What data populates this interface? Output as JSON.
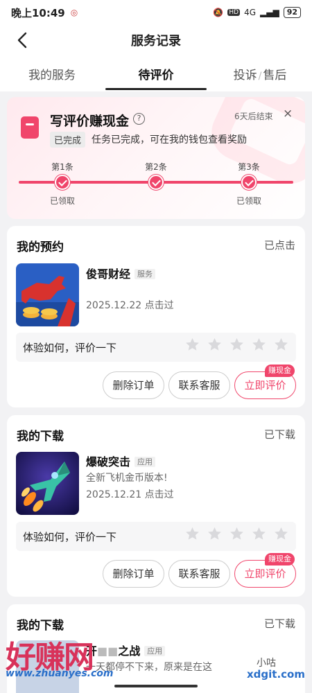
{
  "status_bar": {
    "time": "晚上10:49",
    "network": "4G",
    "battery": "92"
  },
  "navbar": {
    "title": "服务记录"
  },
  "tabs": [
    {
      "label": "我的服务",
      "active": false
    },
    {
      "label": "待评价",
      "active": true
    },
    {
      "label_a": "投诉",
      "label_b": "售后",
      "active": false
    }
  ],
  "promo": {
    "title": "写评价赚现金",
    "help_icon": "?",
    "deadline": "6天后结束",
    "close": "×",
    "done_badge": "已完成",
    "done_desc": "任务已完成，可在我的钱包查看奖励",
    "steps": [
      {
        "label": "第1条",
        "claimed": "已领取"
      },
      {
        "label": "第2条",
        "claimed": ""
      },
      {
        "label": "第3条",
        "claimed": "已领取"
      }
    ],
    "accent_color": "#f0456b"
  },
  "cards": [
    {
      "header": "我的预约",
      "status": "已点击",
      "item_name": "俊哥财经",
      "item_tag": "服务",
      "desc": "",
      "date": "2025.12.22 点击过",
      "rating_prompt": "体验如何，评价一下",
      "stars": 0,
      "buttons": {
        "delete": "删除订单",
        "contact": "联系客服",
        "review": "立即评价"
      },
      "cash_tag": "赚现金"
    },
    {
      "header": "我的下载",
      "status": "已下载",
      "item_name": "爆破突击",
      "item_tag": "应用",
      "desc": "全新飞机金币版本!",
      "date": "2025.12.21 点击过",
      "rating_prompt": "体验如何，评价一下",
      "stars": 0,
      "buttons": {
        "delete": "删除订单",
        "contact": "联系客服",
        "review": "立即评价"
      },
      "cash_tag": "赚现金"
    },
    {
      "header": "我的下载",
      "status": "已下载",
      "item_name": "开",
      "item_name_tail": "之战",
      "item_tag": "应用",
      "desc": "一天都停不下来，原来是在这"
    }
  ],
  "watermark": {
    "brand": "好赚网",
    "url": "www.zhuanyes.com",
    "right": "xdgit.com",
    "xiao": "小",
    "xiao_tail": "咕"
  }
}
